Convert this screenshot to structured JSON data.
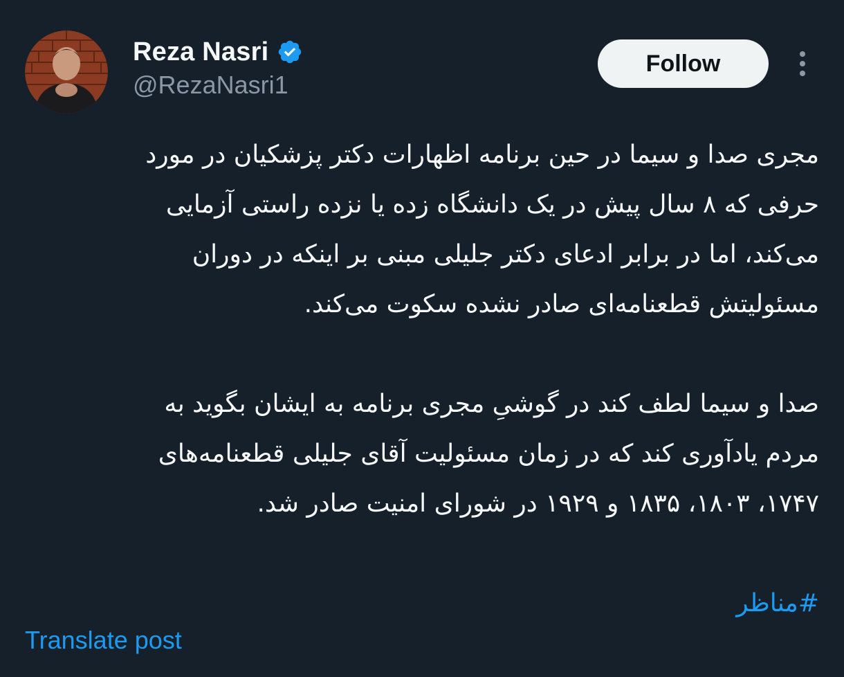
{
  "author": {
    "display_name": "Reza Nasri",
    "handle": "@RezaNasri1",
    "verified": true,
    "avatar_icon": "profile-photo"
  },
  "actions": {
    "follow_label": "Follow",
    "more_icon": "more-dots-vertical-icon"
  },
  "tweet": {
    "paragraph_1": [
      "مجری صدا و سیما در حین برنامه اظهارات دکتر پزشکیان در مورد",
      "حرفی که ۸ سال پیش در یک دانشگاه زده یا نزده راستی آزمایی",
      "می‌کند، اما در برابر ادعای دکتر جلیلی مبنی بر اینکه در دوران",
      "مسئولیتش قطعنامه‌ای صادر نشده سکوت می‌کند."
    ],
    "paragraph_2": [
      "صدا و سیما لطف کند در گوشیِ مجری برنامه به ایشان بگوید به",
      "مردم یادآوری کند که در زمان مسئولیت آقای جلیلی قطعنامه‌های",
      "۱۷۴۷، ۱۸۰۳، ۱۸۳۵ و ۱۹۲۹ در شورای امنیت صادر شد."
    ],
    "hashtag": "#مناظر"
  },
  "footer": {
    "translate_label": "Translate post"
  },
  "colors": {
    "background": "#15202b",
    "text_primary": "#f7f9f9",
    "text_secondary": "#8b98a5",
    "accent": "#1d9bf0",
    "follow_button_bg": "#eff3f4"
  }
}
